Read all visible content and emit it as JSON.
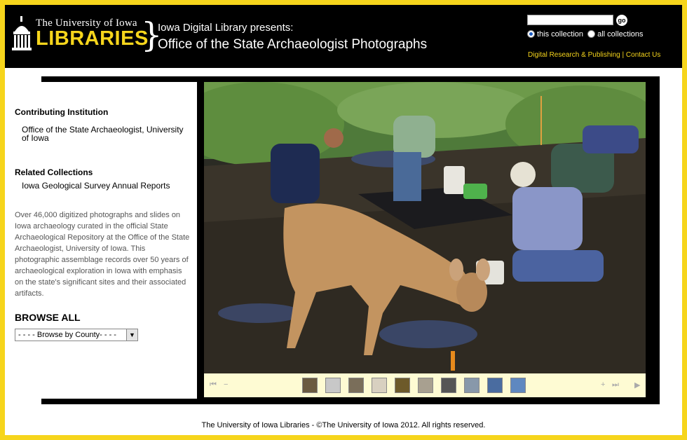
{
  "logo": {
    "top_text": "The University of Iowa",
    "main_text": "LIBRARIES",
    "brace": "}"
  },
  "header": {
    "presents": "Iowa Digital Library presents:",
    "title": "Office of the State Archaeologist Photographs"
  },
  "search": {
    "value": "",
    "go_label": "go",
    "options": [
      "this collection",
      "all collections"
    ],
    "selected": "this collection"
  },
  "links": [
    "Digital Research & Publishing",
    "Contact Us"
  ],
  "links_separator": "|",
  "sidebar": {
    "contrib_heading": "Contributing Institution",
    "contrib_text": "Office of the State Archaeologist, University of Iowa",
    "related_heading": "Related Collections",
    "related_text": "Iowa Geological Survey Annual Reports",
    "description": "Over 46,000 digitized photographs and slides on Iowa archaeology curated in the official State Archaeological Repository at the Office of the State Archaeologist, University of Iowa. This photographic assemblage records over 50 years of archaeological exploration in Iowa with emphasis on the state's significant sites and their associated artifacts.",
    "browse_heading": "BROWSE ALL",
    "county_select": "- - - - Browse by County- - - -"
  },
  "photo": {
    "alt_icon": "excavation-photo-with-deer"
  },
  "footer": "The University of Iowa Libraries - ©The University of Iowa 2012. All rights reserved.",
  "colors": {
    "accent": "#f6d51c",
    "thumb_bar": "#fefbd3",
    "header_bg": "#000000"
  }
}
